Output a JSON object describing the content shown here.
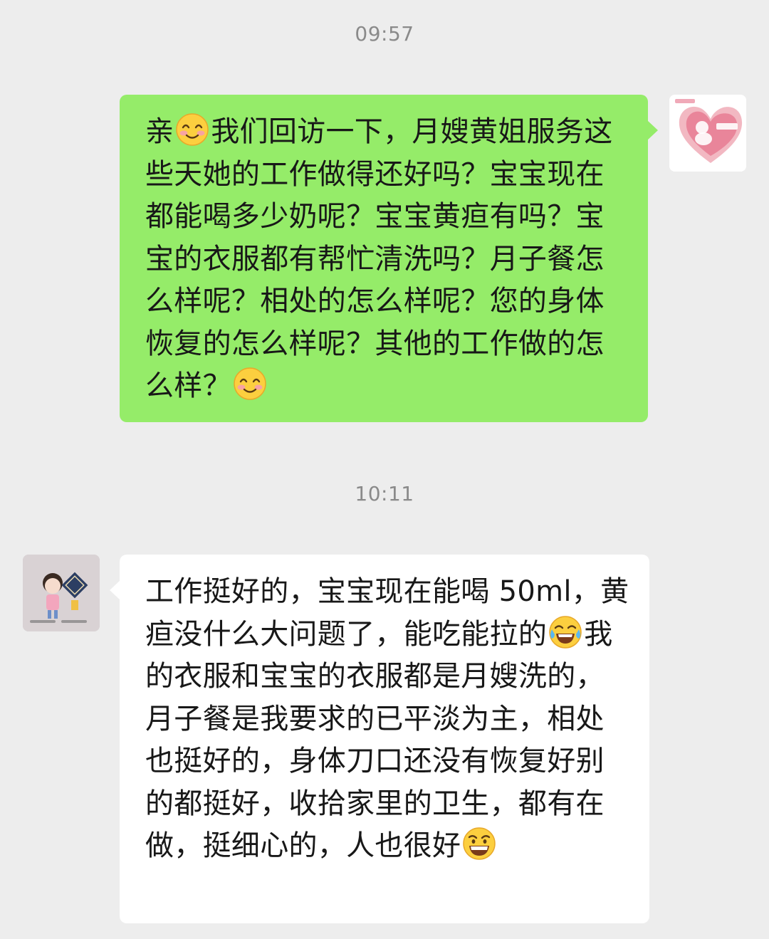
{
  "chat": {
    "timestamp_1": "09:57",
    "timestamp_2": "10:11",
    "sent_message": {
      "part_1": "亲",
      "emoji_1": "smiling-face-emoji",
      "part_2": "我们回访一下，月嫂黄姐服务这些天她的工作做得还好吗？宝宝现在都能喝多少奶呢？宝宝黄疸有吗？宝宝的衣服都有帮忙清洗吗？月子餐怎么样呢？相处的怎么样呢？您的身体恢复的怎么样呢？其他的工作做的怎么样？",
      "emoji_2": "smiling-face-emoji"
    },
    "received_message": {
      "part_1": "工作挺好的，宝宝现在能喝 50ml，黄疸没什么大问题了，能吃能拉的",
      "emoji_1": "tears-of-joy-emoji",
      "part_2": "我的衣服和宝宝的衣服都是月嫂洗的，月子餐是我要求的已平淡为主，相处也挺好的，身体刀口还没有恢复好别的都挺好，收拾家里的卫生，都有在做，挺细心的，人也很好",
      "emoji_2": "grinning-face-emoji"
    },
    "colors": {
      "background": "#ededed",
      "sent_bubble": "#95ec69",
      "received_bubble": "#ffffff",
      "timestamp_text": "#8a8a8a"
    }
  }
}
